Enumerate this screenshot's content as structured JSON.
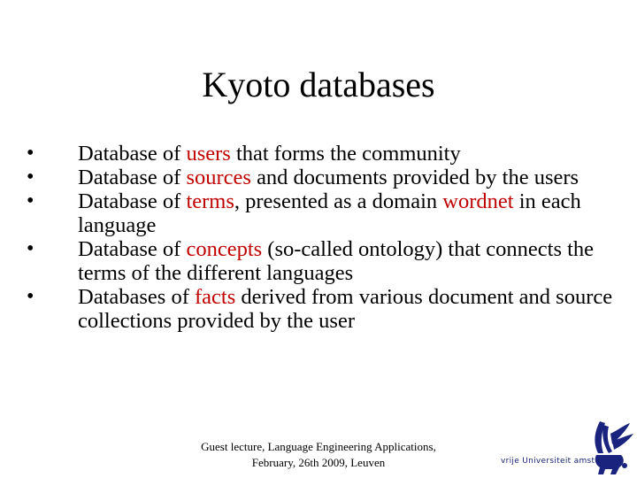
{
  "slide": {
    "title": "Kyoto databases",
    "bullets": [
      {
        "parts": [
          {
            "text": "Database of ",
            "hl": false
          },
          {
            "text": "users",
            "hl": true
          },
          {
            "text": " that forms the community",
            "hl": false
          }
        ]
      },
      {
        "parts": [
          {
            "text": "Database of ",
            "hl": false
          },
          {
            "text": "sources",
            "hl": true
          },
          {
            "text": " and documents provided by the users",
            "hl": false
          }
        ]
      },
      {
        "parts": [
          {
            "text": "Database of ",
            "hl": false
          },
          {
            "text": "terms",
            "hl": true
          },
          {
            "text": ", presented as a domain ",
            "hl": false
          },
          {
            "text": "wordnet",
            "hl": true
          },
          {
            "text": " in each language",
            "hl": false
          }
        ]
      },
      {
        "parts": [
          {
            "text": "Database of ",
            "hl": false
          },
          {
            "text": "concepts",
            "hl": true
          },
          {
            "text": " (so-called ontology) that connects the terms of the different languages",
            "hl": false
          }
        ]
      },
      {
        "parts": [
          {
            "text": "Databases of ",
            "hl": false
          },
          {
            "text": "facts",
            "hl": true
          },
          {
            "text": " derived from various document and source collections provided by the user",
            "hl": false
          }
        ]
      }
    ],
    "bullet_glyph": "•",
    "footer": {
      "line1": "Guest lecture, Language Engineering Applications,",
      "line2": "February, 26th 2009, Leuven"
    },
    "logo": {
      "text": "vrije Universiteit   amsterdam",
      "icon": "griffin-logo-icon"
    },
    "colors": {
      "highlight": "#c00000",
      "logo": "#1a237e"
    }
  }
}
